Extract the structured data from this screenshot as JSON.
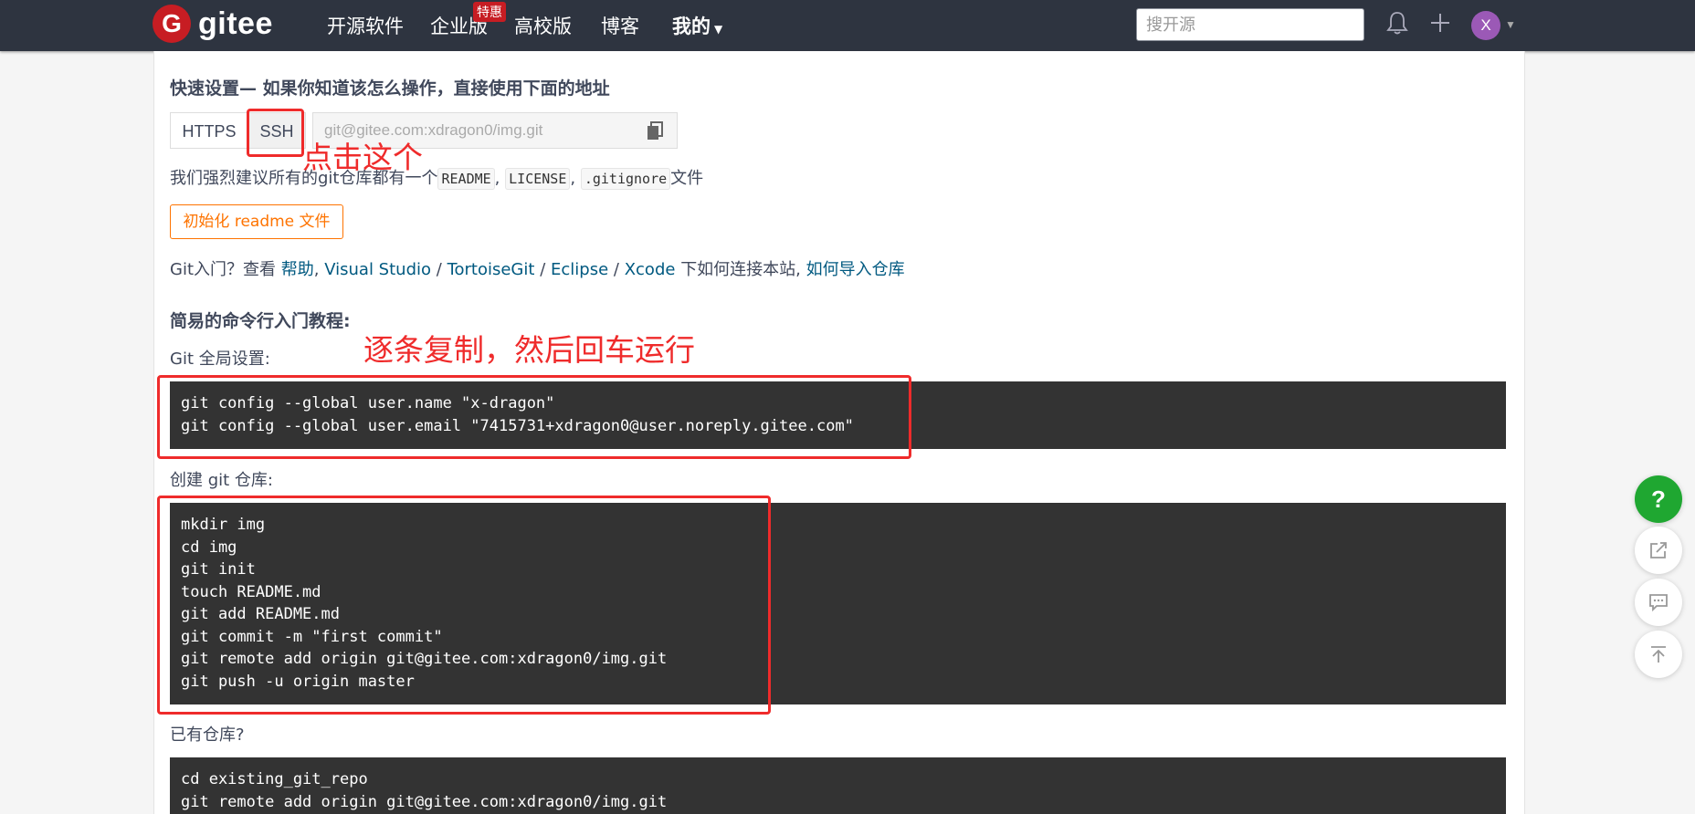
{
  "nav": {
    "logo_mark": "G",
    "logo_text": "gitee",
    "items": [
      "开源软件",
      "企业版",
      "高校版",
      "博客",
      "我的"
    ],
    "badge": "特惠",
    "search_placeholder": "搜开源",
    "avatar_letter": "X"
  },
  "quick_setup": {
    "heading": "快速设置— 如果你知道该怎么操作，直接使用下面的地址",
    "https_label": "HTTPS",
    "ssh_label": "SSH",
    "url": "git@gitee.com:xdragon0/img.git",
    "recommend_prefix": "我们强烈建议所有的git仓库都有一个",
    "readme": "README",
    "sep1": ",",
    "license": "LICENSE",
    "sep2": ",",
    "gitignore": ".gitignore",
    "recommend_suffix": "文件",
    "init_button": "初始化 readme 文件",
    "intro_prefix": "Git入门？查看",
    "help_link": "帮助",
    "comma": ",",
    "vs_link": "Visual Studio",
    "slash1": "/",
    "tortoise_link": "TortoiseGit",
    "slash2": "/",
    "eclipse_link": "Eclipse",
    "slash3": "/",
    "xcode_link": "Xcode",
    "intro_middle": "下如何连接本站,",
    "import_link": "如何导入仓库"
  },
  "tutorial": {
    "heading": "简易的命令行入门教程:",
    "global_label": "Git 全局设置:",
    "global_cmds": [
      "git config --global user.name \"x-dragon\"",
      "git config --global user.email \"7415731+xdragon0@user.noreply.gitee.com\""
    ],
    "create_label": "创建 git 仓库:",
    "create_cmds": [
      "mkdir img",
      "cd img",
      "git init",
      "touch README.md",
      "git add README.md",
      "git commit -m \"first commit\"",
      "git remote add origin git@gitee.com:xdragon0/img.git",
      "git push -u origin master"
    ],
    "existing_label": "已有仓库?",
    "existing_cmds": [
      "cd existing_git_repo",
      "git remote add origin git@gitee.com:xdragon0/img.git"
    ]
  },
  "annotations": {
    "click_this": "点击这个",
    "copy_run": "逐条复制，然后回车运行"
  },
  "fab": {
    "help": "?"
  },
  "colors": {
    "nav_bg": "#2e3440",
    "brand_red": "#c71d23",
    "annotation_red": "#ef2b2b",
    "link": "#005980",
    "orange": "#fe7300",
    "code_bg": "#333333",
    "help_green": "#1fa731"
  }
}
